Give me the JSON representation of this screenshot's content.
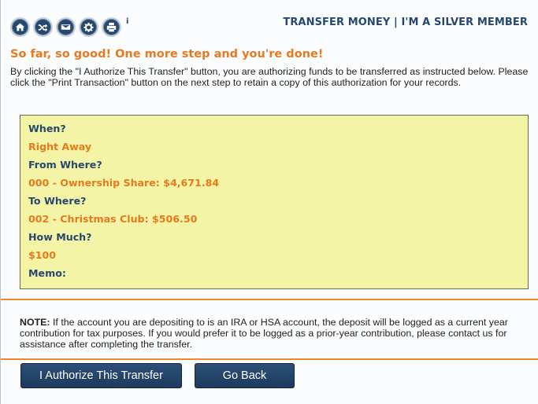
{
  "header": {
    "title": "TRANSFER MONEY | I'M A SILVER MEMBER",
    "info_glyph": "i",
    "toolbar_icons": [
      "home-icon",
      "shuffle-icon",
      "mail-icon",
      "gear-icon",
      "print-icon"
    ]
  },
  "headline": "So far, so good! One more step and you're done!",
  "intro": "By clicking the \"I Authorize This Transfer\" button, you are authorizing funds to be transferred as instructed below. Please click the \"Print Transaction\" button on the next step to retain a copy of this authorization for your records.",
  "summary": {
    "when_label": "When?",
    "when_value": "Right Away",
    "from_label": "From Where?",
    "from_value": "000 - Ownership Share: $4,671.84",
    "to_label": "To Where?",
    "to_value": "002 - Christmas Club: $506.50",
    "amount_label": "How Much?",
    "amount_value": "$100",
    "memo_label": "Memo:",
    "memo_value": ""
  },
  "note": {
    "prefix": "NOTE:",
    "text": " If the account you are depositing to is an IRA or HSA account, the deposit will be logged as a current year contribution for tax purposes. If you would prefer it to be logged as a prior-year contribution, please contact us for assistance after completing the transfer."
  },
  "buttons": {
    "authorize": "I Authorize This Transfer",
    "back": "Go Back"
  },
  "colors": {
    "navy": "#27486e",
    "orange": "#e8791d",
    "summary_bg": "#f4f4a6",
    "rule": "#e88a2f"
  }
}
